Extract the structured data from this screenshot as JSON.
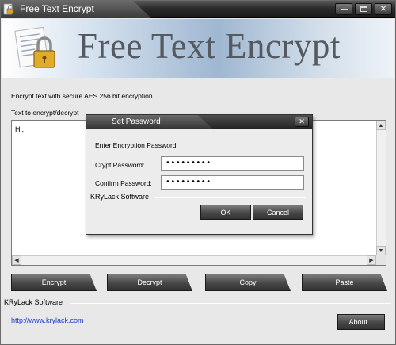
{
  "window": {
    "title": "Free Text Encrypt",
    "banner_title": "Free Text Encrypt",
    "subtitle": "Encrypt text with secure AES 256 bit encryption",
    "textarea_label": "Text to encrypt/decrypt",
    "textarea_value": "Hi,",
    "buttons": {
      "encrypt": "Encrypt",
      "decrypt": "Decrypt",
      "copy": "Copy",
      "paste": "Paste",
      "about": "About..."
    },
    "group_label": "KRyLack Software",
    "link": "http://www.krylack.com"
  },
  "dialog": {
    "title": "Set Password",
    "header": "Enter Encryption Password",
    "crypt_label": "Crypt Password:",
    "crypt_value": "•••••••••",
    "confirm_label": "Confirm Password:",
    "confirm_value": "•••••••••",
    "group_label": "KRyLack Software",
    "ok": "OK",
    "cancel": "Cancel"
  },
  "icons": {
    "app": "lock-document-icon",
    "minimize": "minimize-icon",
    "maximize": "maximize-icon",
    "close": "close-icon"
  }
}
